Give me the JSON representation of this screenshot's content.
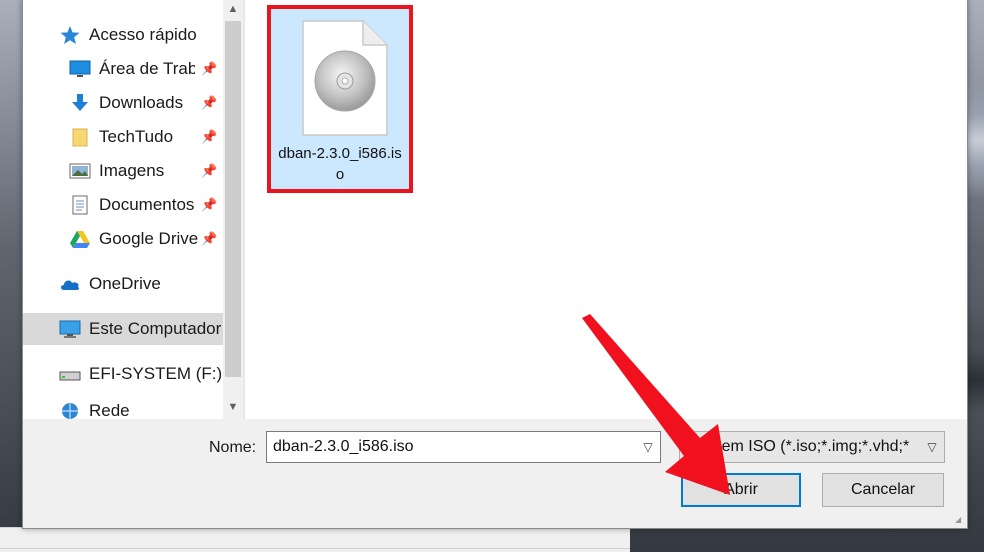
{
  "nav": {
    "items": [
      {
        "label": "Acesso rápido",
        "icon": "star-icon",
        "pinned": false
      },
      {
        "label": "Área de Trabalho",
        "icon": "desktop-icon",
        "pinned": true
      },
      {
        "label": "Downloads",
        "icon": "download-icon",
        "pinned": true
      },
      {
        "label": "TechTudo",
        "icon": "folder-icon",
        "pinned": true
      },
      {
        "label": "Imagens",
        "icon": "pictures-icon",
        "pinned": true
      },
      {
        "label": "Documentos",
        "icon": "documents-icon",
        "pinned": true
      },
      {
        "label": "Google Drive",
        "icon": "google-drive-icon",
        "pinned": true
      },
      {
        "label": "OneDrive",
        "icon": "onedrive-icon",
        "pinned": false
      },
      {
        "label": "Este Computador",
        "icon": "computer-icon",
        "pinned": false,
        "selected": true
      },
      {
        "label": "EFI-SYSTEM (F:)",
        "icon": "drive-icon",
        "pinned": false
      },
      {
        "label": "Rede",
        "icon": "network-icon",
        "pinned": false
      }
    ]
  },
  "file": {
    "name": "dban-2.3.0_i586.iso",
    "icon": "disc-image-icon",
    "highlight_color": "#e8141e"
  },
  "footer": {
    "name_label": "Nome:",
    "name_value": "dban-2.3.0_i586.iso",
    "type_value": "Imagem ISO (*.iso;*.img;*.vhd;*",
    "open_label": "Abrir",
    "cancel_label": "Cancelar"
  },
  "colors": {
    "selection": "#cce8ff",
    "accent": "#0078d7",
    "annotation": "#f0101e"
  }
}
